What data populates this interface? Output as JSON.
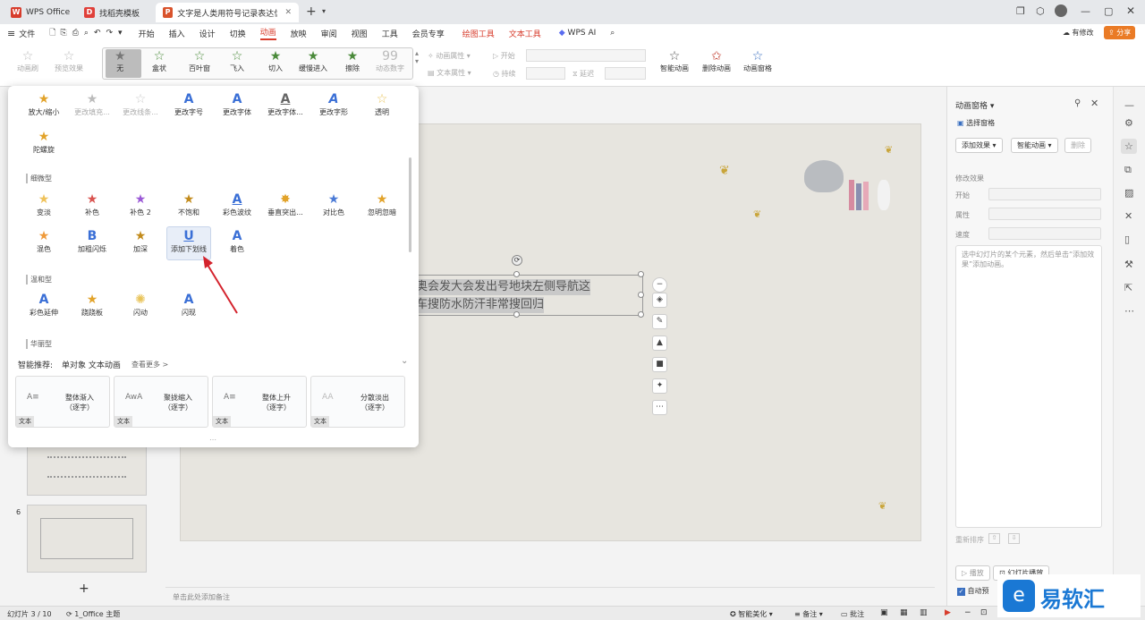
{
  "tabs": [
    {
      "label": "WPS Office",
      "icon": "wps-logo-icon"
    },
    {
      "label": "找稻壳模板",
      "icon": "daoke-icon"
    },
    {
      "label": "文字是人类用符号记录表达信息以",
      "icon": "ppt-icon"
    }
  ],
  "new_tab": "+",
  "menubar": {
    "file": "文件",
    "items": [
      "开始",
      "插入",
      "设计",
      "切换",
      "动画",
      "放映",
      "审阅",
      "视图",
      "工具",
      "会员专享"
    ],
    "active": "动画",
    "context": [
      "绘图工具",
      "文本工具"
    ],
    "wps_ai": "WPS AI",
    "modified": "有修改",
    "share": "分享"
  },
  "ribbon": {
    "anim_label": "动画刷",
    "preview_label": "预览效果",
    "effects": [
      "无",
      "盒状",
      "百叶窗",
      "飞入",
      "切入",
      "缓慢进入",
      "擦除",
      "动态数字"
    ],
    "anim_property": "动画属性",
    "text_property": "文本属性",
    "start_label": "开始",
    "duration_label": "持续",
    "delay_label": "延迟",
    "smart_anim": "智能动画",
    "delete_anim": "删除动画",
    "anim_pane": "动画窗格"
  },
  "popup": {
    "top_effects": [
      "放大/缩小",
      "更改填充...",
      "更改线条...",
      "更改字号",
      "更改字体",
      "更改字体...",
      "更改字形",
      "透明"
    ],
    "top_effects2": [
      "陀螺旋"
    ],
    "sections": {
      "subtle": "细微型",
      "moderate": "温和型",
      "exciting": "华丽型"
    },
    "subtle_row1": [
      "变淡",
      "补色",
      "补色 2",
      "不饱和",
      "彩色波纹",
      "垂直突出...",
      "对比色",
      "忽明忽暗"
    ],
    "subtle_row2": [
      "混色",
      "加粗闪烁",
      "加深",
      "添加下划线",
      "着色"
    ],
    "moderate_row": [
      "彩色延伸",
      "跷跷板",
      "闪动",
      "闪现"
    ],
    "smart_recommend": "智能推荐:",
    "smart_sub": "单对象 文本动画",
    "see_more": "查看更多 >",
    "cards": [
      {
        "label": "整体渐入\n（逐字）",
        "tag": "文本"
      },
      {
        "label": "聚拢缩入\n（逐字）",
        "tag": "文本"
      },
      {
        "label": "整体上升\n（逐字）",
        "tag": "文本"
      },
      {
        "label": "分散淡出\n（逐字）",
        "tag": "文本"
      }
    ]
  },
  "slide": {
    "line1": "奥会发大会发出号地块左侧导航这",
    "line2": "车搜防水防汗非常搜回归"
  },
  "thumb_number": "6",
  "add_slide": "+",
  "notes_placeholder": "单击此处添加备注",
  "right": {
    "title": "动画窗格",
    "select_pane": "选择窗格",
    "add_effect": "添加效果",
    "smart_anim": "智能动画",
    "delete": "删除",
    "modify": "修改效果",
    "start": "开始",
    "property": "属性",
    "speed": "速度",
    "hint": "选中幻灯片的某个元素，然后单击“添加效果”添加动画。",
    "reorder": "重新排序",
    "play": "播放",
    "slideshow": "幻灯片播放",
    "autopreview": "自动预"
  },
  "status": {
    "slide": "幻灯片 3 / 10",
    "theme": "1_Office 主题",
    "beautify": "智能美化",
    "notes": "备注",
    "comments": "批注"
  },
  "watermark": "易软汇",
  "colors": {
    "accent": "#d73c2c",
    "share": "#ea7b26"
  }
}
